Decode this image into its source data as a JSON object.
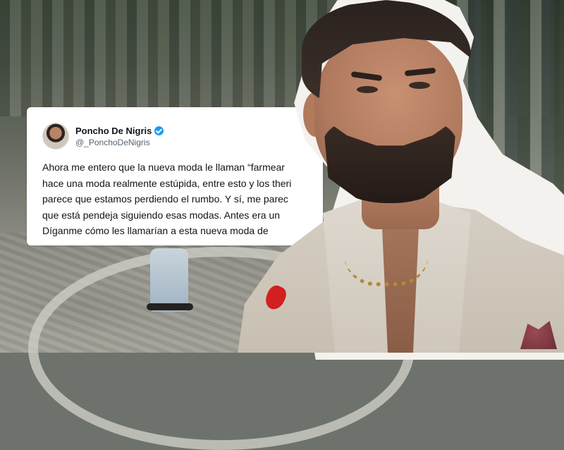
{
  "tweet": {
    "display_name": "Poncho De Nigris",
    "handle": "@_PonchoDeNigris",
    "verified_icon": "verified-badge-icon",
    "lines": [
      "Ahora me entero que la nueva moda le llaman “farmear",
      "hace una moda realmente estúpida, entre esto y los theri",
      "parece que estamos perdiendo el rumbo. Y sí, me parec",
      "que está pendeja siguiendo esas modas. Antes era un",
      "Díganme cómo les llamarían a esta nueva moda de"
    ]
  },
  "colors": {
    "verified": "#1d9bf0",
    "name_text": "#0f1419",
    "handle_text": "#536471",
    "card_bg": "#ffffff"
  }
}
